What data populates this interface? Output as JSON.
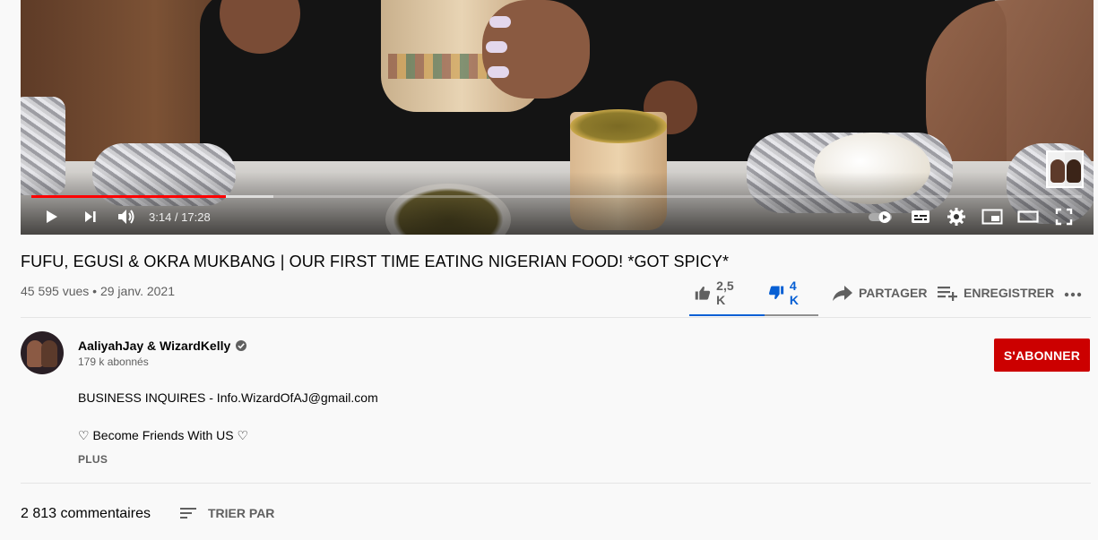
{
  "player": {
    "time_current": "3:14",
    "time_separator": " / ",
    "time_total": "17:28",
    "progress_played": 0.185,
    "progress_buffered": 0.23,
    "icons": [
      "play-icon",
      "next-icon",
      "volume-icon",
      "autoplay-toggle-icon",
      "subtitles-icon",
      "settings-icon",
      "miniplayer-icon",
      "theater-icon",
      "fullscreen-icon"
    ]
  },
  "video": {
    "title": "FUFU, EGUSI & OKRA MUKBANG | OUR FIRST TIME EATING NIGERIAN FOOD! *GOT SPICY*",
    "meta": "45 595 vues • 29 janv. 2021"
  },
  "actions": {
    "likes": "2,5 K",
    "dislikes": "4 K",
    "share": "PARTAGER",
    "save": "ENREGISTRER",
    "dislike_color": "#065fd4"
  },
  "channel": {
    "name": "AaliyahJay & WizardKelly",
    "subscribers": "179 k abonnés",
    "subscribe_label": "S'ABONNER",
    "subscribe_color": "#cc0000"
  },
  "description": {
    "lines": [
      "BUSINESS INQUIRES - Info.WizardOfAJ@gmail.com",
      "♡ Become Friends With US ♡"
    ],
    "more_label": "PLUS"
  },
  "comments": {
    "count": "2 813 commentaires",
    "sort_label": "TRIER PAR"
  }
}
